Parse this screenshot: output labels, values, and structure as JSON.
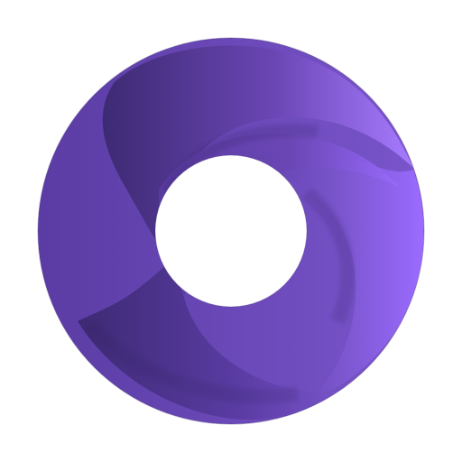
{
  "logo": {
    "icon": "purple-swirl-ring",
    "colors": {
      "background": "#ffffff",
      "base": "#6a46b4",
      "dark": "#3d2a73",
      "mid": "#5a3ca3",
      "light": "#9b6bff",
      "highlight": "#a77bff"
    }
  }
}
